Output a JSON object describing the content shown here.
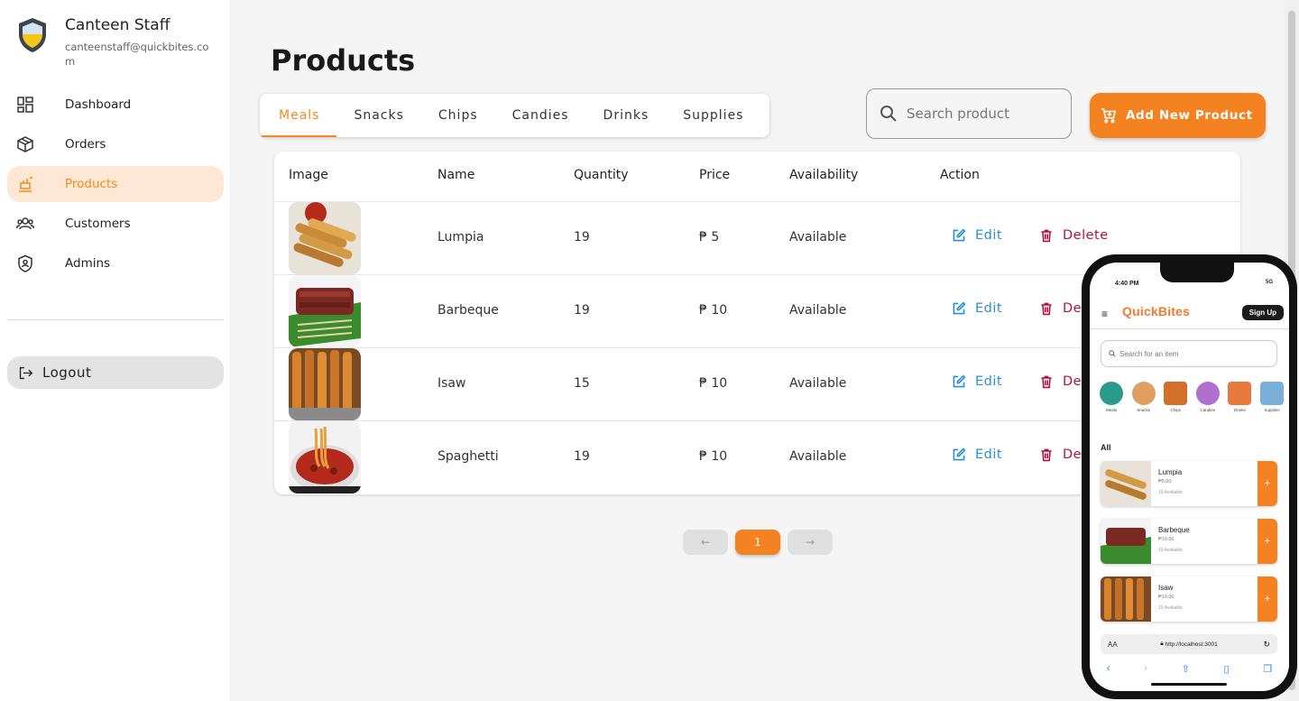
{
  "profile": {
    "name": "Canteen Staff",
    "email": "canteenstaff@quickbites.com"
  },
  "nav": [
    {
      "label": "Dashboard",
      "icon": "dashboard-icon"
    },
    {
      "label": "Orders",
      "icon": "box-icon"
    },
    {
      "label": "Products",
      "icon": "products-icon",
      "active": true
    },
    {
      "label": "Customers",
      "icon": "customers-icon"
    },
    {
      "label": "Admins",
      "icon": "admin-shield-icon"
    }
  ],
  "logout_label": "Logout",
  "page_title": "Products",
  "tabs": [
    "Meals",
    "Snacks",
    "Chips",
    "Candies",
    "Drinks",
    "Supplies"
  ],
  "active_tab": "Meals",
  "search": {
    "placeholder": "Search product"
  },
  "add_button_label": "Add New Product",
  "table": {
    "headers": [
      "Image",
      "Name",
      "Quantity",
      "Price",
      "Availability",
      "Action"
    ],
    "rows": [
      {
        "name": "Lumpia",
        "quantity": "19",
        "price": "₱ 5",
        "availability": "Available"
      },
      {
        "name": "Barbeque",
        "quantity": "19",
        "price": "₱ 10",
        "availability": "Available"
      },
      {
        "name": "Isaw",
        "quantity": "15",
        "price": "₱ 10",
        "availability": "Available"
      },
      {
        "name": "Spaghetti",
        "quantity": "19",
        "price": "₱ 10",
        "availability": "Available"
      }
    ],
    "edit_label": "Edit",
    "delete_label": "Delete"
  },
  "pagination": {
    "prev": "←",
    "current": "1",
    "next": "→"
  },
  "colors": {
    "accent": "#f58220",
    "edit": "#2a8fd6",
    "delete": "#b5123a",
    "active_nav_bg": "#fde8d6"
  },
  "phone": {
    "time": "4:40 PM",
    "status": "5G",
    "logo": "QuickBites",
    "signup": "Sign Up",
    "search_placeholder": "Search for an item",
    "categories": [
      "Meals",
      "Snacks",
      "Chips",
      "Candies",
      "Drinks",
      "Supplies"
    ],
    "section": "All",
    "items": [
      {
        "name": "Lumpia",
        "price": "₱5.00",
        "avail": "19 Available"
      },
      {
        "name": "Barbeque",
        "price": "₱10.00",
        "avail": "19 Available"
      },
      {
        "name": "Isaw",
        "price": "₱10.00",
        "avail": "15 Available"
      }
    ],
    "url": "http://localhost:3001",
    "aa": "AA"
  }
}
